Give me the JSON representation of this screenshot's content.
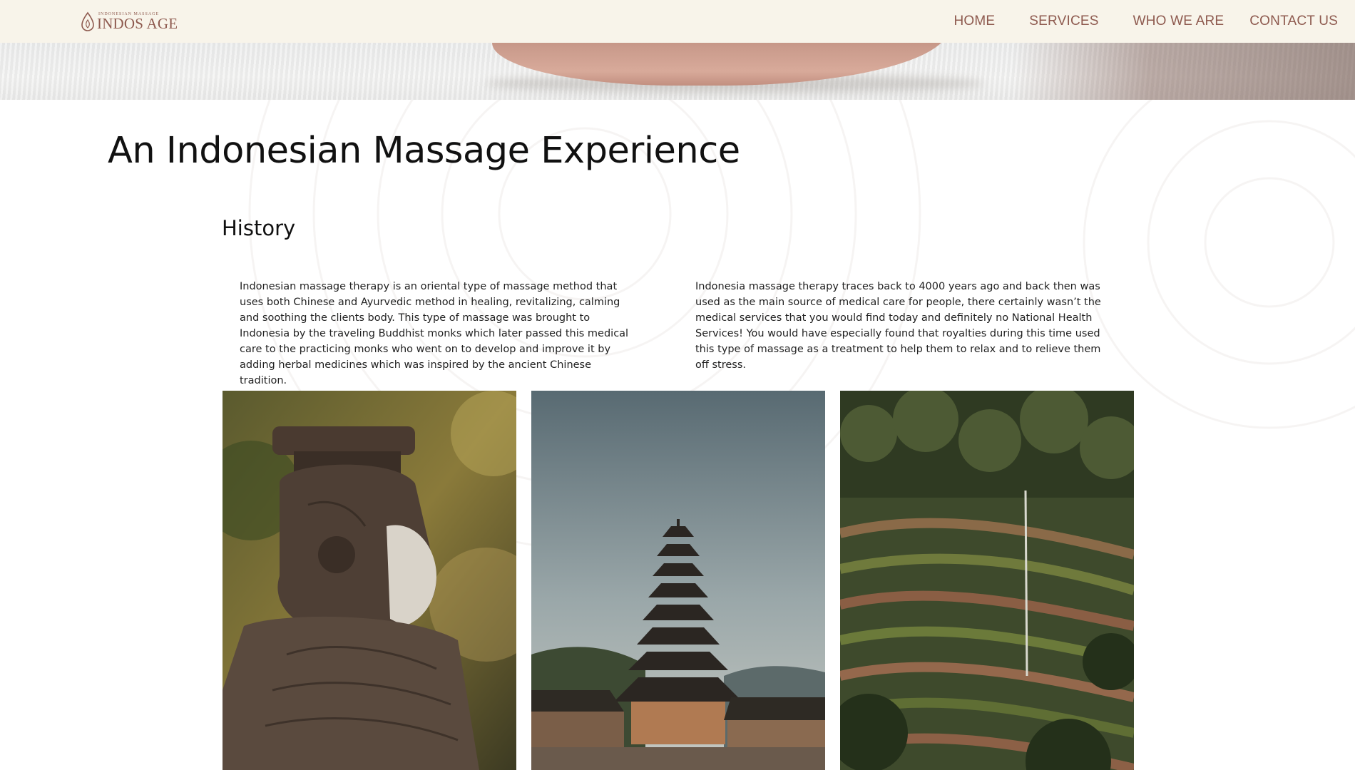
{
  "header": {
    "logo_small": "INDONESIAN MASSAGE",
    "logo_big": "INDOS AGE",
    "nav": [
      "HOME",
      "SERVICES",
      "WHO WE ARE",
      "CONTACT US"
    ]
  },
  "main": {
    "title": "An Indonesian Massage Experience",
    "section_title": "History",
    "paragraphs": [
      "Indonesian massage therapy is an oriental type of massage method that uses both Chinese and Ayurvedic method in healing, revitalizing, calming and soothing the clients body. This type of massage was brought to Indonesia by the traveling Buddhist monks which later passed this medical care to the practicing monks who went on to develop and improve it by adding herbal medicines which was inspired by the ancient Chinese tradition.",
      "Indonesia massage therapy traces back to 4000 years ago and back then was used as the main source of medical care for people, there certainly wasn’t the medical services that you would find today and definitely no National Health Services! You would have especially found that royalties during this time used this type of massage as a treatment to help them to relax and to relieve them off stress."
    ]
  },
  "colors": {
    "accent": "#8e5a4f",
    "header_bg": "#f8f4ea"
  }
}
